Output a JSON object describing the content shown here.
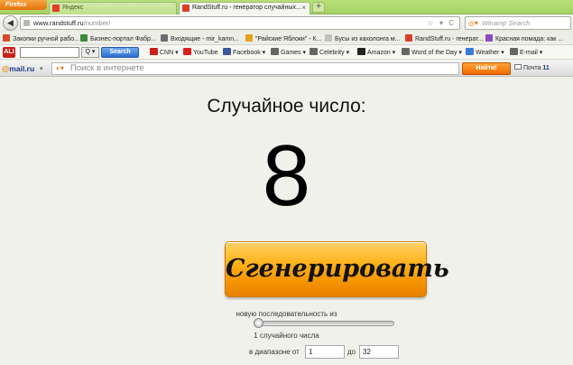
{
  "browser": {
    "app_button": "Firefox",
    "tabs": [
      {
        "label": "Яндекс",
        "active": false,
        "close": ""
      },
      {
        "label": "RandStuff.ru - генератор случайных...",
        "active": true,
        "close": "×"
      }
    ],
    "new_tab": "+",
    "url_host": "www.randstuff.ru",
    "url_path": "/number/",
    "url_icons": "☆ ▾ C",
    "search_placeholder": "Winamp Search"
  },
  "bookmarks": [
    {
      "label": "Закопки ручной рабо...",
      "color": "#d84a2a"
    },
    {
      "label": "Бизнес-портал Фабр...",
      "color": "#3a8a3a"
    },
    {
      "label": "Входящие - mir_kamn...",
      "color": "#6b6b6b"
    },
    {
      "label": "\"Райские Яблоки\" - К...",
      "color": "#e4a21a"
    },
    {
      "label": "Бусы из кахолонга м...",
      "color": "#c0c0c0"
    },
    {
      "label": "RandStuff.ru - генерат...",
      "color": "#d8402a"
    },
    {
      "label": "Красная помада: как ...",
      "color": "#8a4ac0"
    }
  ],
  "toolbar": {
    "logo": "ALI",
    "q_label": "Q ▾",
    "search_button": "Search",
    "links": [
      {
        "label": "CNN ▾",
        "color": "#c8201a"
      },
      {
        "label": "YouTube",
        "color": "#d8201a"
      },
      {
        "label": "Facebook ▾",
        "color": "#3b5998"
      },
      {
        "label": "Games ▾",
        "color": "#666666"
      },
      {
        "label": "Celebrity ▾",
        "color": "#666666"
      },
      {
        "label": "Amazon ▾",
        "color": "#222222"
      },
      {
        "label": "Word of the Day ▾",
        "color": "#666666"
      },
      {
        "label": "Weather ▾",
        "color": "#3a7ad8"
      },
      {
        "label": "E-mail ▾",
        "color": "#666666"
      }
    ]
  },
  "mailru": {
    "logo_at": "@",
    "logo_text": "mail.ru",
    "dropdown": "▾",
    "search_placeholder": "Поиск в интернете",
    "find_button": "Найти!",
    "mail_label": "Почта",
    "mail_count": "11"
  },
  "page": {
    "heading": "Случайное число:",
    "number": "8",
    "generate_button": "Сгенерировать",
    "sequence_label": "новую последовательность из",
    "slider_value": 0,
    "count_label": "1 случайного числа",
    "range_from_label": "в диапазоне от",
    "range_from_value": "1",
    "range_to_label": "до",
    "range_to_value": "32"
  },
  "colors": {
    "tabbar": "#a6d265",
    "button": "#ffb21a"
  }
}
